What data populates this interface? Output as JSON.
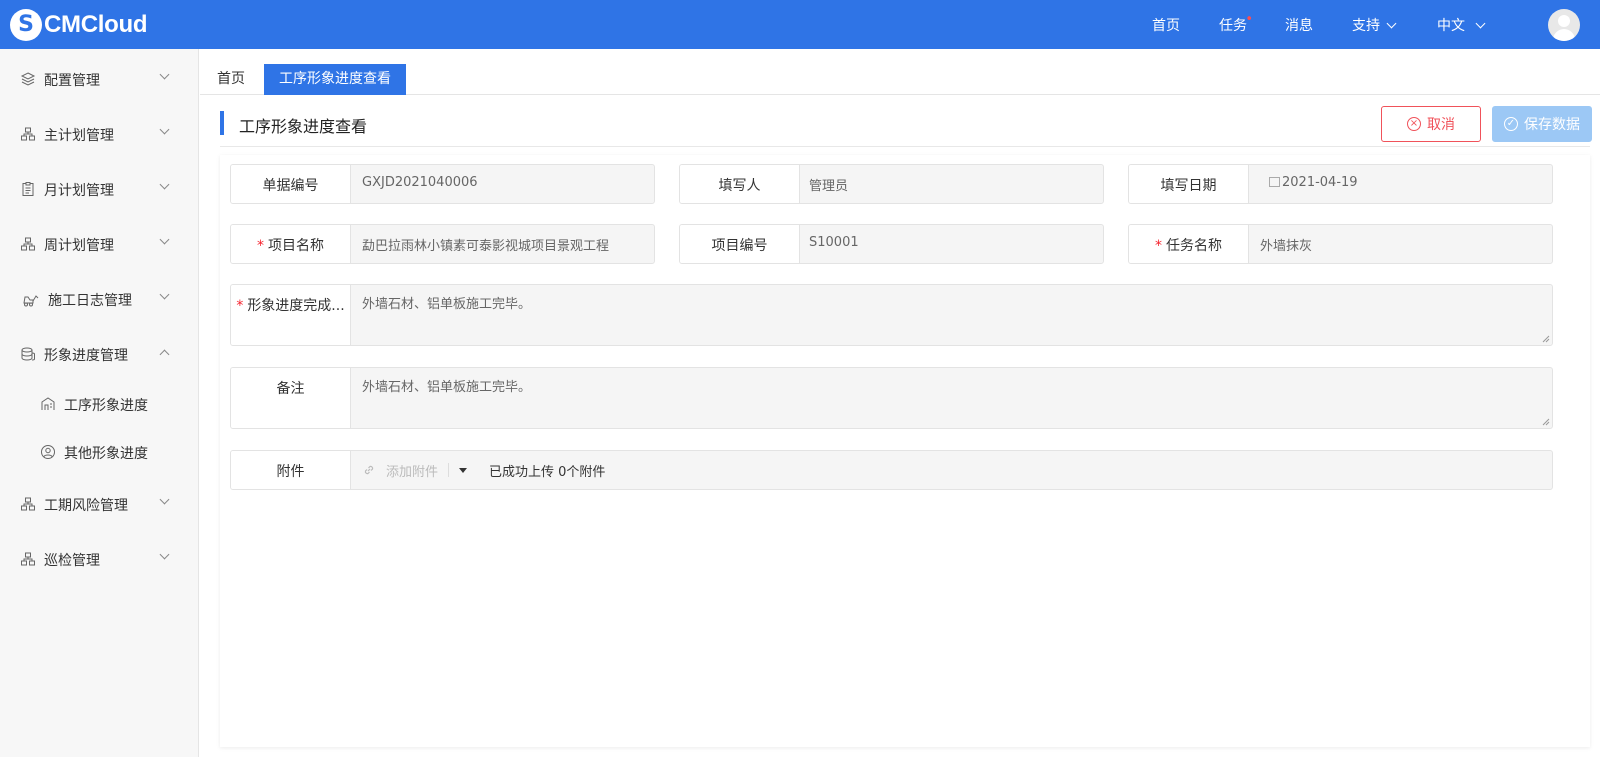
{
  "app": {
    "logo_text": "CMCloud",
    "logo_letter": "S"
  },
  "topnav": {
    "home": "首页",
    "tasks": "任务",
    "tasks_dot": "•",
    "messages": "消息",
    "support": "支持",
    "language": "中文"
  },
  "sidebar": {
    "items": [
      {
        "label": "配置管理",
        "icon": "layers-icon"
      },
      {
        "label": "主计划管理",
        "icon": "org-chart-icon"
      },
      {
        "label": "月计划管理",
        "icon": "clipboard-icon"
      },
      {
        "label": "周计划管理",
        "icon": "org-chart-icon"
      },
      {
        "label": "施工日志管理",
        "icon": "excavator-icon"
      },
      {
        "label": "形象进度管理",
        "icon": "coins-icon",
        "expanded": true
      },
      {
        "label": "工期风险管理",
        "icon": "org-chart-icon"
      },
      {
        "label": "巡检管理",
        "icon": "org-chart-icon"
      }
    ],
    "sub_items": [
      {
        "label": "工序形象进度",
        "icon": "building-icon"
      },
      {
        "label": "其他形象进度",
        "icon": "user-circle-icon"
      }
    ]
  },
  "tabs": {
    "home": "首页",
    "active": "工序形象进度查看"
  },
  "page": {
    "title": "工序形象进度查看",
    "cancel_label": "取消",
    "save_label": "保存数据"
  },
  "form": {
    "doc_no": {
      "label": "单据编号",
      "value": "GXJD2021040006"
    },
    "filler": {
      "label": "填写人",
      "value": "管理员"
    },
    "fill_date": {
      "label": "填写日期",
      "value": "2021-04-19"
    },
    "project_name": {
      "label": "项目名称",
      "value": "勐巴拉雨林小镇素可泰影视城项目景观工程",
      "required": "*"
    },
    "project_no": {
      "label": "项目编号",
      "value": "S10001"
    },
    "task_name": {
      "label": "任务名称",
      "value": "外墙抹灰",
      "required": "*"
    },
    "progress_desc": {
      "label": "形象进度完成...",
      "value": "外墙石材、铝单板施工完毕。",
      "required": "*"
    },
    "remark": {
      "label": "备注",
      "value": "外墙石材、铝单板施工完毕。"
    },
    "attachment": {
      "label": "附件",
      "add_label": "添加附件",
      "status": "已成功上传 0个附件"
    }
  },
  "colors": {
    "primary": "#2f74e6",
    "danger": "#f0525a",
    "save_disabled": "#9cc8f5"
  }
}
